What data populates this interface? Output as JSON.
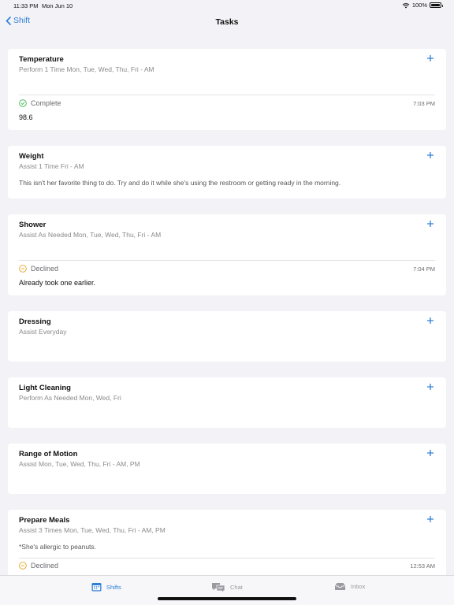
{
  "status_bar": {
    "time": "11:33 PM",
    "date": "Mon Jun 10",
    "battery": "100%"
  },
  "nav": {
    "back_label": "Shift",
    "title": "Tasks"
  },
  "tasks": [
    {
      "title": "Temperature",
      "subtitle": "Perform 1 Time Mon, Tue, Wed, Thu, Fri - AM",
      "status": {
        "state": "Complete",
        "time": "7:03 PM",
        "value": "98.6"
      }
    },
    {
      "title": "Weight",
      "subtitle": "Assist 1 Time Fri - AM",
      "note": "This isn't her favorite thing to do. Try and do it while she's using the restroom or getting ready in the morning."
    },
    {
      "title": "Shower",
      "subtitle": "Assist As Needed Mon, Tue, Wed, Thu, Fri - AM",
      "status": {
        "state": "Declined",
        "time": "7:04 PM",
        "value": "Already took one earlier."
      }
    },
    {
      "title": "Dressing",
      "subtitle": "Assist Everyday"
    },
    {
      "title": "Light Cleaning",
      "subtitle": "Perform As Needed Mon, Wed, Fri"
    },
    {
      "title": "Range of Motion",
      "subtitle": "Assist Mon, Tue, Wed, Thu, Fri - AM, PM"
    },
    {
      "title": "Prepare Meals",
      "subtitle": "Assist 3 Times Mon, Tue, Wed, Thu, Fri - AM, PM",
      "note": "*She's allergic to peanuts.",
      "status": {
        "state": "Declined",
        "time": "12:53 AM"
      }
    }
  ],
  "tab_bar": {
    "shifts": "Shifts",
    "chat": "Chat",
    "inbox": "Inbox"
  },
  "colors": {
    "accent": "#2f7fd6",
    "complete": "#3bb54a",
    "declined": "#e3a21a"
  }
}
